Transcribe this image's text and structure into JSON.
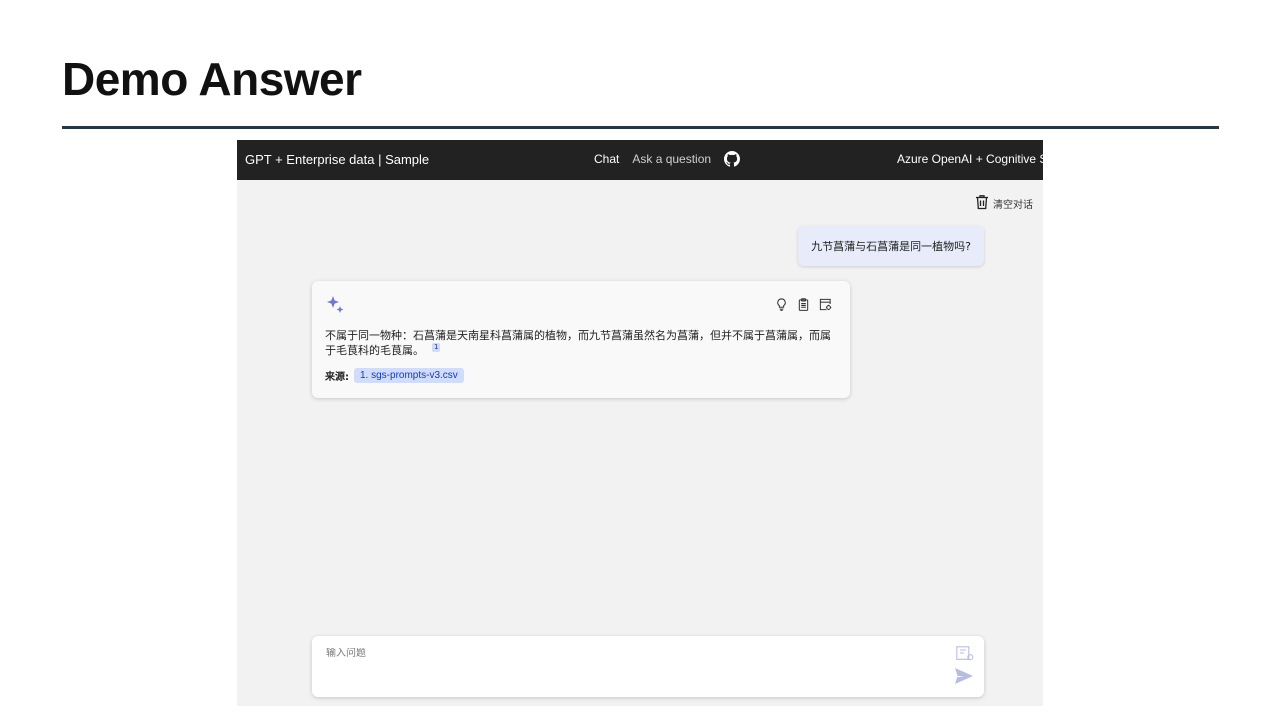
{
  "slide": {
    "title": "Demo Answer"
  },
  "header": {
    "brand": "GPT + Enterprise data | Sample",
    "nav": [
      {
        "label": "Chat"
      },
      {
        "label": "Ask a question"
      }
    ],
    "github_icon": "github-icon",
    "right_text": "Azure OpenAI + Cognitive Sea"
  },
  "chat": {
    "clear_label": "清空对话",
    "user_message": "九节菖蒲与石菖蒲是同一植物吗?",
    "answer": {
      "text": "不属于同一物种：石菖蒲是天南星科菖蒲属的植物，而九节菖蒲虽然名为菖蒲，但并不属于菖蒲属，而属于毛茛科的毛茛属。",
      "citation_marker": "1",
      "sources_label": "来源:",
      "sources": [
        "1. sgs-prompts-v3.csv"
      ],
      "action_icons": [
        "lightbulb-icon",
        "clipboard-icon",
        "supporting-content-icon"
      ]
    }
  },
  "input": {
    "placeholder": "输入问题",
    "value": ""
  },
  "colors": {
    "header_bg": "#222222",
    "accent": "#7078c9",
    "chip_bg": "#d1dbfa",
    "user_bubble": "#e8ebfa",
    "title_rule": "#243746"
  }
}
